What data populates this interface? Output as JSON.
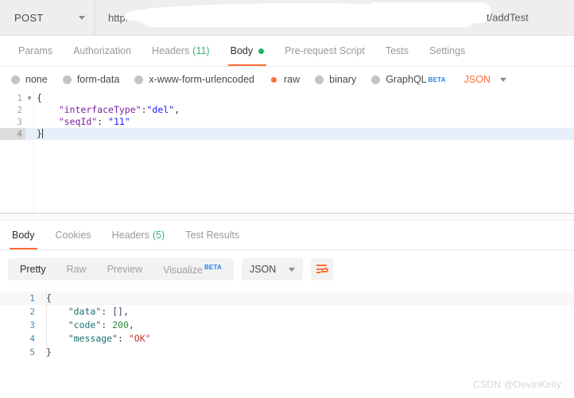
{
  "request_bar": {
    "method": "POST",
    "method_caret_icon": "chevron-down-icon",
    "url_prefix": "http:",
    "url_suffix": "t/addTest",
    "url_redacted": true
  },
  "request_tabs": [
    {
      "label": "Params",
      "active": false
    },
    {
      "label": "Authorization",
      "active": false
    },
    {
      "label": "Headers",
      "count": "(11)",
      "active": false
    },
    {
      "label": "Body",
      "active": true,
      "dot": true
    },
    {
      "label": "Pre-request Script",
      "active": false
    },
    {
      "label": "Tests",
      "active": false
    },
    {
      "label": "Settings",
      "active": false
    }
  ],
  "body_types": [
    {
      "label": "none",
      "selected": false
    },
    {
      "label": "form-data",
      "selected": false
    },
    {
      "label": "x-www-form-urlencoded",
      "selected": false
    },
    {
      "label": "raw",
      "selected": true
    },
    {
      "label": "binary",
      "selected": false
    },
    {
      "label": "GraphQL",
      "selected": false,
      "badge": "BETA"
    }
  ],
  "body_format": {
    "label": "JSON",
    "caret_icon": "chevron-down-icon"
  },
  "request_body": {
    "language": "json",
    "lines": [
      {
        "num": "1",
        "fold": true,
        "active": false,
        "tokens": [
          {
            "t": "{",
            "c": "p-req"
          }
        ]
      },
      {
        "num": "2",
        "fold": false,
        "active": false,
        "tokens": [
          {
            "t": "    ",
            "c": "p-req"
          },
          {
            "t": "\"interfaceType\"",
            "c": "k-req"
          },
          {
            "t": ":",
            "c": "p-req"
          },
          {
            "t": "\"del\"",
            "c": "v-req"
          },
          {
            "t": ",",
            "c": "p-req"
          }
        ]
      },
      {
        "num": "3",
        "fold": false,
        "active": false,
        "tokens": [
          {
            "t": "    ",
            "c": "p-req"
          },
          {
            "t": "\"seqId\"",
            "c": "k-req"
          },
          {
            "t": ": ",
            "c": "p-req"
          },
          {
            "t": "\"11\"",
            "c": "v-req"
          }
        ]
      },
      {
        "num": "4",
        "fold": false,
        "active": true,
        "tokens": [
          {
            "t": "}",
            "c": "p-req"
          }
        ],
        "caret": true
      }
    ]
  },
  "response_tabs": [
    {
      "label": "Body",
      "active": true
    },
    {
      "label": "Cookies",
      "active": false
    },
    {
      "label": "Headers",
      "count": "(5)",
      "active": false
    },
    {
      "label": "Test Results",
      "active": false
    }
  ],
  "response_toolbar": {
    "views": [
      {
        "label": "Pretty",
        "active": true
      },
      {
        "label": "Raw",
        "active": false
      },
      {
        "label": "Preview",
        "active": false
      },
      {
        "label": "Visualize",
        "active": false,
        "badge": "BETA"
      }
    ],
    "format": {
      "label": "JSON",
      "caret_icon": "chevron-down-icon"
    },
    "wrap_button_icon": "word-wrap-icon"
  },
  "response_body": {
    "language": "json",
    "lines": [
      {
        "num": "1",
        "first": true,
        "tokens": [
          {
            "t": "{",
            "c": "p-res"
          }
        ]
      },
      {
        "num": "2",
        "first": false,
        "tokens": [
          {
            "t": "    ",
            "c": "p-res"
          },
          {
            "t": "\"data\"",
            "c": "k-res"
          },
          {
            "t": ": ",
            "c": "p-res"
          },
          {
            "t": "[]",
            "c": "p-res"
          },
          {
            "t": ",",
            "c": "p-res"
          }
        ]
      },
      {
        "num": "3",
        "first": false,
        "tokens": [
          {
            "t": "    ",
            "c": "p-res"
          },
          {
            "t": "\"code\"",
            "c": "k-res"
          },
          {
            "t": ": ",
            "c": "p-res"
          },
          {
            "t": "200",
            "c": "n-res"
          },
          {
            "t": ",",
            "c": "p-res"
          }
        ]
      },
      {
        "num": "4",
        "first": false,
        "tokens": [
          {
            "t": "    ",
            "c": "p-res"
          },
          {
            "t": "\"message\"",
            "c": "k-res"
          },
          {
            "t": ": ",
            "c": "p-res"
          },
          {
            "t": "\"OK\"",
            "c": "s-res"
          }
        ]
      },
      {
        "num": "5",
        "first": false,
        "tokens": [
          {
            "t": "}",
            "c": "p-res"
          }
        ]
      }
    ]
  },
  "watermark": "CSDN @DevinKelly",
  "colors": {
    "accent_orange": "#ff6c37",
    "badge_blue": "#2680eb",
    "count_green": "#3bb273",
    "dot_green": "#1bb55c",
    "active_line": "#e6effa"
  }
}
